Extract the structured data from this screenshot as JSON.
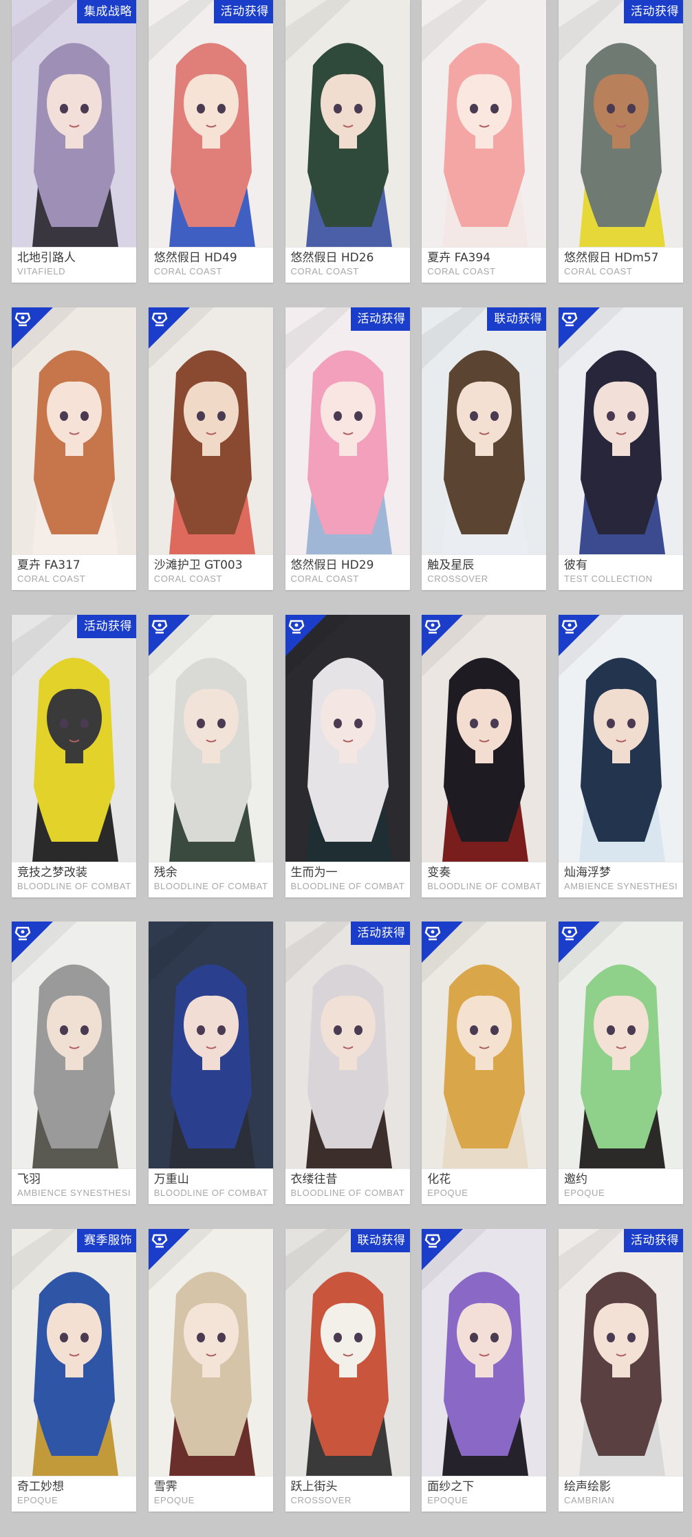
{
  "skins": [
    {
      "name": "北地引路人",
      "series": "VITAFIELD",
      "badge": "集成战略",
      "bg": "#d9d3e6",
      "hair": "#9d8fb5",
      "outfit": "#3a3640",
      "skin": "#f3dfd9"
    },
    {
      "name": "悠然假日 HD49",
      "series": "CORAL COAST",
      "badge": "活动获得",
      "bg": "#f2eeee",
      "hair": "#e07e79",
      "outfit": "#3f5fc2",
      "skin": "#f7e2d6"
    },
    {
      "name": "悠然假日 HD26",
      "series": "CORAL COAST",
      "badge": "",
      "bg": "#ecebe6",
      "hair": "#2f4a3a",
      "outfit": "#4b5ea8",
      "skin": "#f1ddcf"
    },
    {
      "name": "夏卉 FA394",
      "series": "CORAL COAST",
      "badge": "",
      "bg": "#f3eeee",
      "hair": "#f4a6a4",
      "outfit": "#f3e8e6",
      "skin": "#fae7df"
    },
    {
      "name": "悠然假日 HDm57",
      "series": "CORAL COAST",
      "badge": "活动获得",
      "bg": "#eeecea",
      "hair": "#6f7a72",
      "outfit": "#e7d83a",
      "skin": "#b9815b"
    },
    {
      "name": "夏卉 FA317",
      "series": "CORAL COAST",
      "badge": "",
      "corner": true,
      "bg": "#efe9e4",
      "hair": "#c7764b",
      "outfit": "#f5ede8",
      "skin": "#f6e2d6"
    },
    {
      "name": "沙滩护卫 GT003",
      "series": "CORAL COAST",
      "badge": "",
      "corner": true,
      "bg": "#eeeae6",
      "hair": "#8a4a32",
      "outfit": "#dd6a5c",
      "skin": "#f1d9c8"
    },
    {
      "name": "悠然假日 HD29",
      "series": "CORAL COAST",
      "badge": "活动获得",
      "bg": "#f3edf0",
      "hair": "#f2a0bb",
      "outfit": "#9fb6d6",
      "skin": "#f9e6e2"
    },
    {
      "name": "触及星辰",
      "series": "CROSSOVER",
      "badge": "联动获得",
      "bg": "#e9ecee",
      "hair": "#5c4432",
      "outfit": "#eaeef2",
      "skin": "#f3e0d2"
    },
    {
      "name": "彼有",
      "series": "TEST COLLECTION",
      "badge": "",
      "corner": true,
      "bg": "#eceef2",
      "hair": "#27263a",
      "outfit": "#3c4a8f",
      "skin": "#f2e0d8"
    },
    {
      "name": "竞技之梦改装",
      "series": "BLOODLINE OF COMBAT",
      "badge": "活动获得",
      "bg": "#e6e6e6",
      "hair": "#e2d22a",
      "outfit": "#2a2a2a",
      "skin": "#3a3a3a"
    },
    {
      "name": "残余",
      "series": "BLOODLINE OF COMBAT",
      "badge": "",
      "corner": true,
      "bg": "#eeeeea",
      "hair": "#d9d9d6",
      "outfit": "#3a4a3f",
      "skin": "#f2e3d8"
    },
    {
      "name": "生而为一",
      "series": "BLOODLINE OF COMBAT",
      "badge": "",
      "corner": true,
      "bg": "#2b2a2e",
      "hair": "#e5e3e6",
      "outfit": "#1f2e33",
      "skin": "#f4e6e2"
    },
    {
      "name": "变奏",
      "series": "BLOODLINE OF COMBAT",
      "badge": "",
      "corner": true,
      "bg": "#ebe6e2",
      "hair": "#1e1c22",
      "outfit": "#7a1d1d",
      "skin": "#f2ddd0"
    },
    {
      "name": "灿海浮梦",
      "series": "AMBIENCE SYNESTHESIA",
      "badge": "",
      "corner": true,
      "bg": "#eef1f4",
      "hair": "#23344f",
      "outfit": "#d9e6f0",
      "skin": "#f1ddd0"
    },
    {
      "name": "飞羽",
      "series": "AMBIENCE SYNESTHESIA",
      "badge": "",
      "corner": true,
      "bg": "#eeeeec",
      "hair": "#9a9a9a",
      "outfit": "#5a5a52",
      "skin": "#f0dfd3"
    },
    {
      "name": "万重山",
      "series": "BLOODLINE OF COMBAT",
      "badge": "",
      "bg": "#2f3a4e",
      "hair": "#2b3f8f",
      "outfit": "#2b2f3a",
      "skin": "#f2ddd4"
    },
    {
      "name": "衣缕往昔",
      "series": "BLOODLINE OF COMBAT",
      "badge": "活动获得",
      "bg": "#e7e4e1",
      "hair": "#d8d4d8",
      "outfit": "#3c2f2b",
      "skin": "#f0e0d6"
    },
    {
      "name": "化花",
      "series": "EPOQUE",
      "badge": "",
      "corner": true,
      "bg": "#ece8e2",
      "hair": "#d9a64a",
      "outfit": "#e8dcc8",
      "skin": "#f4e1cf"
    },
    {
      "name": "邀约",
      "series": "EPOQUE",
      "badge": "",
      "corner": true,
      "bg": "#eceeea",
      "hair": "#8fd08a",
      "outfit": "#2c2a28",
      "skin": "#f2e1d4"
    },
    {
      "name": "奇工妙想",
      "series": "EPOQUE",
      "badge": "赛季服饰",
      "bg": "#ecebe6",
      "hair": "#2f55a6",
      "outfit": "#c29a3a",
      "skin": "#f3e0d3"
    },
    {
      "name": "雪霁",
      "series": "EPOQUE",
      "badge": "",
      "corner": true,
      "bg": "#f1efe9",
      "hair": "#d5c4a8",
      "outfit": "#6a2f2b",
      "skin": "#f4e4d8"
    },
    {
      "name": "跃上街头",
      "series": "CROSSOVER",
      "badge": "联动获得",
      "bg": "#e5e3e0",
      "hair": "#c8553c",
      "outfit": "#3b3a3a",
      "skin": "#f3f0ea"
    },
    {
      "name": "面纱之下",
      "series": "EPOQUE",
      "badge": "",
      "corner": true,
      "bg": "#e8e4ec",
      "hair": "#8a69c6",
      "outfit": "#25222c",
      "skin": "#f3dfd8"
    },
    {
      "name": "绘声绘影",
      "series": "CAMBRIAN",
      "badge": "活动获得",
      "bg": "#eeebe8",
      "hair": "#5a4040",
      "outfit": "#d9d9da",
      "skin": "#f3e1d6"
    }
  ]
}
